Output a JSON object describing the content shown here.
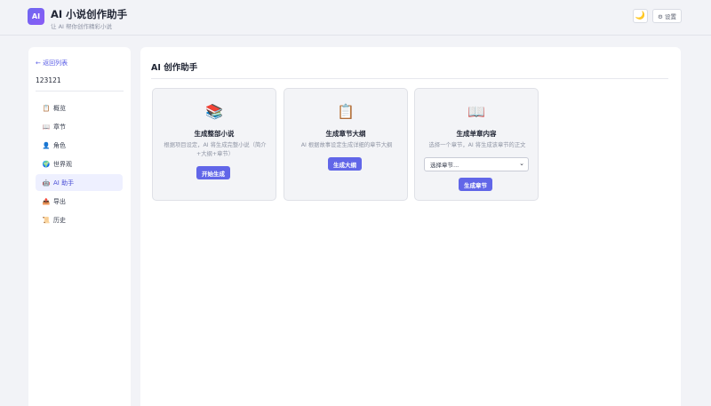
{
  "header": {
    "logo_text": "AI",
    "title": "AI 小说创作助手",
    "subtitle": "让 AI 帮你创作精彩小说",
    "theme_icon": "🌙",
    "settings_label": "⚙ 设置"
  },
  "sidebar": {
    "back_label": "← 返回列表",
    "project_name": "123121",
    "items": [
      {
        "icon": "📋",
        "label": "概览"
      },
      {
        "icon": "📖",
        "label": "章节"
      },
      {
        "icon": "👤",
        "label": "角色"
      },
      {
        "icon": "🌍",
        "label": "世界观"
      },
      {
        "icon": "🤖",
        "label": "AI 助手"
      },
      {
        "icon": "📤",
        "label": "导出"
      },
      {
        "icon": "📜",
        "label": "历史"
      }
    ],
    "active_index": 4
  },
  "main": {
    "title": "AI 创作助手",
    "cards": [
      {
        "icon": "📚",
        "title": "生成整部小说",
        "desc": "根据项目设定，AI 将生成完整小说（简介+大纲+章节）",
        "button": "开始生成"
      },
      {
        "icon": "📋",
        "title": "生成章节大纲",
        "desc": "AI 根据故事设定生成详细的章节大纲",
        "button": "生成大纲"
      },
      {
        "icon": "📖",
        "title": "生成单章内容",
        "desc": "选择一个章节，AI 将生成该章节的正文",
        "select_value": "选择章节...",
        "button": "生成章节"
      }
    ]
  },
  "colors": {
    "accent": "#6166e8",
    "background": "#f2f3f7",
    "active_nav_bg": "#eef0ff"
  }
}
